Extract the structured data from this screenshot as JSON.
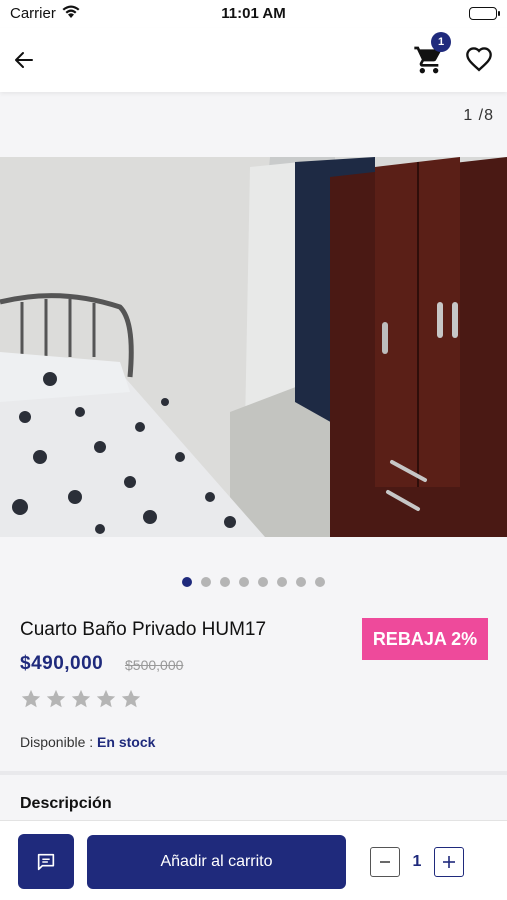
{
  "status_bar": {
    "carrier": "Carrier",
    "time": "11:01 AM"
  },
  "nav": {
    "cart_count": "1",
    "cart_icon": "cart-icon",
    "back_icon": "arrow-left-icon",
    "favorite_icon": "heart-icon"
  },
  "gallery": {
    "counter": "1 /8",
    "total_images": 8,
    "active_index": 0
  },
  "product": {
    "title": "Cuarto Baño Privado HUM17",
    "sale_badge": "REBAJA 2%",
    "price": "$490,000",
    "old_price": "$500,000",
    "rating": 0,
    "max_rating": 5,
    "availability_label": "Disponible :",
    "availability_value": "En stock"
  },
  "description": {
    "heading": "Descripción"
  },
  "bottom_bar": {
    "add_to_cart_label": "Añadir al carrito",
    "quantity": "1",
    "chat_icon": "chat-icon",
    "minus_icon": "minus-icon",
    "plus_icon": "plus-icon"
  },
  "colors": {
    "primary": "#1f2a7c",
    "sale": "#ee4a9b",
    "star_empty": "#b5b5b5"
  }
}
